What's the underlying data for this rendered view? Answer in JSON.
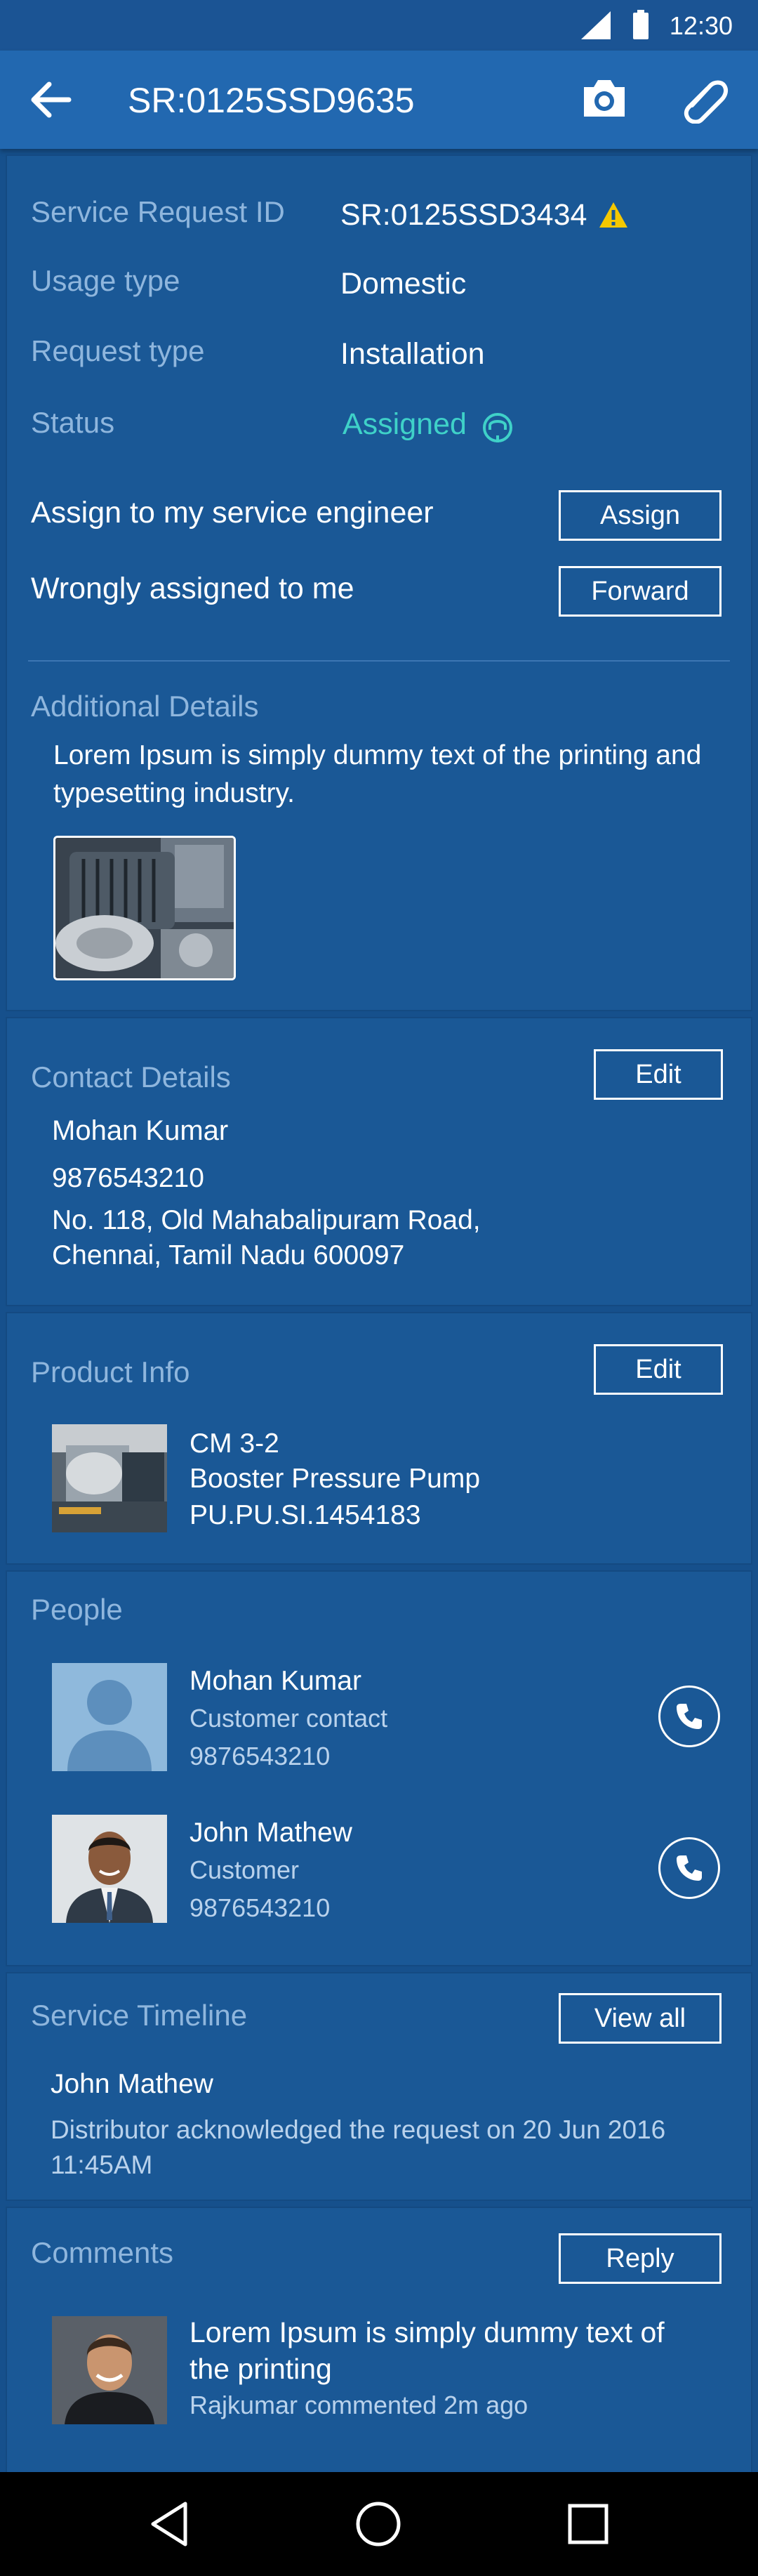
{
  "statusbar": {
    "time": "12:30"
  },
  "appbar": {
    "title": "SR:0125SSD9635"
  },
  "request": {
    "id_label": "Service Request ID",
    "id_value": "SR:0125SSD3434",
    "usage_label": "Usage type",
    "usage_value": "Domestic",
    "type_label": "Request type",
    "type_value": "Installation",
    "status_label": "Status",
    "status_value": "Assigned",
    "status_color": "#3fd1c8",
    "warning_color": "#f5c800",
    "assign_text": "Assign to my service engineer",
    "assign_button": "Assign",
    "wrong_text": "Wrongly assigned to me",
    "forward_button": "Forward",
    "additional_label": "Additional Details",
    "additional_text_line1": "Lorem Ipsum is simply dummy text of the printing and",
    "additional_text_line2": "typesetting industry."
  },
  "contact": {
    "label": "Contact Details",
    "edit": "Edit",
    "name": "Mohan Kumar",
    "phone": "9876543210",
    "address_line1": "No. 118, Old Mahabalipuram Road,",
    "address_line2": "Chennai, Tamil Nadu 600097"
  },
  "product": {
    "label": "Product Info",
    "edit": "Edit",
    "model": "CM 3-2",
    "name": "Booster Pressure Pump",
    "serial": "PU.PU.SI.1454183"
  },
  "people": {
    "label": "People",
    "list": [
      {
        "name": "Mohan Kumar",
        "role": "Customer contact",
        "phone": "9876543210"
      },
      {
        "name": "John Mathew",
        "role": "Customer",
        "phone": "9876543210"
      }
    ]
  },
  "timeline": {
    "label": "Service Timeline",
    "view_all": "View all",
    "name": "John Mathew",
    "text_line1": "Distributor acknowledged the request on 20 Jun 2016",
    "text_line2": "11:45AM"
  },
  "comments": {
    "label": "Comments",
    "reply": "Reply",
    "text_line1": "Lorem Ipsum is simply dummy text of",
    "text_line2": "the printing",
    "meta": "Rajkumar commented 2m ago"
  }
}
